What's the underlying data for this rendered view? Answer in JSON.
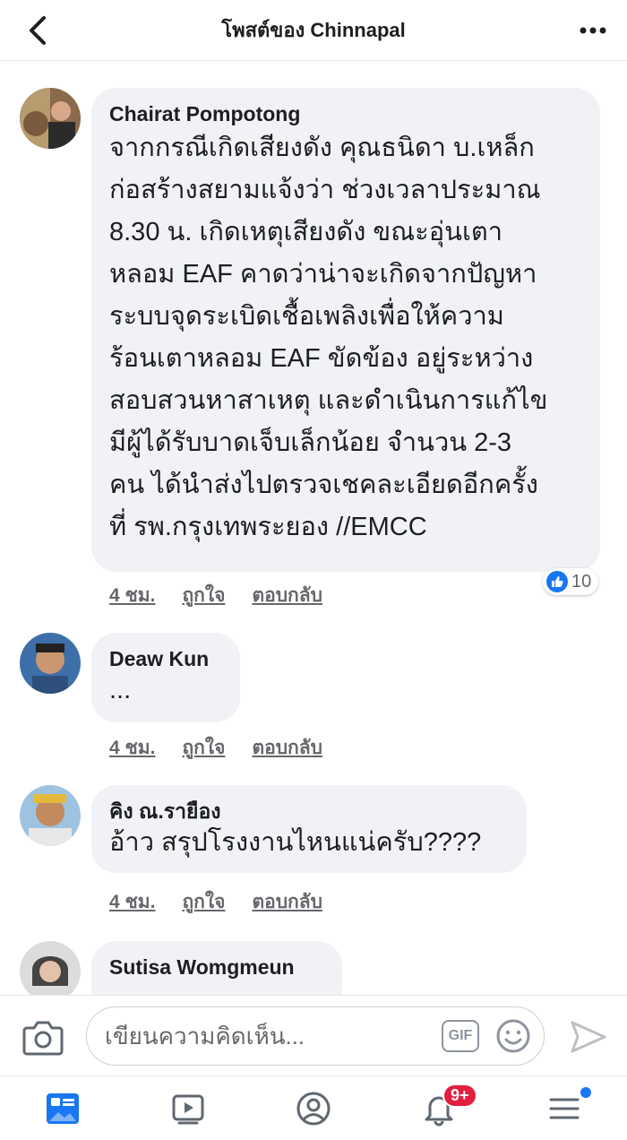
{
  "header": {
    "title": "โพสต์ของ Chinnapal",
    "back_icon": "chevron-left-icon",
    "more_icon": "more-horizontal-icon"
  },
  "comments": [
    {
      "author": "Chairat Pompotong",
      "text": "จากกรณีเกิดเสียงดัง คุณธนิดา บ.เหล็ก\nก่อสร้างสยามแจ้งว่า ช่วงเวลาประมาณ\n8.30 น. เกิดเหตุเสียงดัง ขณะอุ่นเตา\nหลอม EAF คาดว่าน่าจะเกิดจากปัญหา\nระบบจุดระเบิดเชื้อเพลิงเพื่อให้ความ\nร้อนเตาหลอม EAF ขัดข้อง อยู่ระหว่าง\nสอบสวนหาสาเหตุ และดำเนินการแก้ไข\nมีผู้ได้รับบาดเจ็บเล็กน้อย จำนวน 2-3\nคน ได้นำส่งไปตรวจเชคละเอียดอีกครั้ง\nที่ รพ.กรุงเทพระยอง //EMCC",
      "time": "4 ชม.",
      "like": "ถูกใจ",
      "reply": "ตอบกลับ",
      "reactions": "10"
    },
    {
      "author": "Deaw Kun",
      "text": "...",
      "time": "4 ชม.",
      "like": "ถูกใจ",
      "reply": "ตอบกลับ"
    },
    {
      "author": "คิง ณ.รายือง",
      "text": "อ้าว สรุปโรงงานไหนแน่ครับ????",
      "time": "4 ชม.",
      "like": "ถูกใจ",
      "reply": "ตอบกลับ"
    },
    {
      "author": "Sutisa Womgmeun"
    }
  ],
  "composer": {
    "placeholder": "เขียนความคิดเห็น...",
    "gif_label": "GIF",
    "camera_icon": "camera-icon",
    "emoji_icon": "emoji-icon",
    "send_icon": "send-icon"
  },
  "nav": {
    "items": [
      "news-feed-icon",
      "watch-icon",
      "profile-icon",
      "notifications-icon",
      "menu-icon"
    ],
    "notification_badge": "9+"
  },
  "colors": {
    "accent": "#1877f2",
    "bubble": "#f0f2f5",
    "badge": "#e41e3f",
    "muted": "#65676b"
  }
}
